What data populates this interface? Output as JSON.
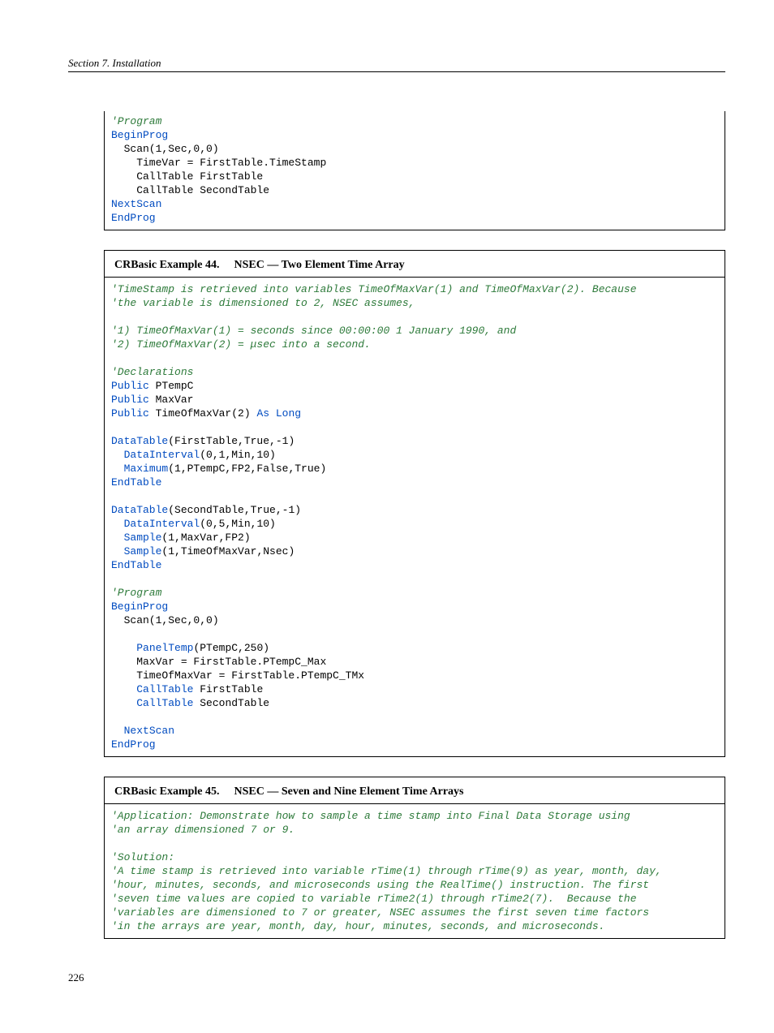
{
  "header": {
    "text": "Section 7.  Installation"
  },
  "footer": {
    "page_number": "226"
  },
  "box1": {
    "code": [
      {
        "t": "cm",
        "v": "'Program"
      },
      {
        "t": "kw",
        "v": "BeginProg"
      },
      {
        "t": "pl",
        "v": "  Scan(1,Sec,0,0)"
      },
      {
        "t": "pl",
        "v": "    TimeVar = FirstTable.TimeStamp"
      },
      {
        "t": "pl",
        "v": "    CallTable FirstTable"
      },
      {
        "t": "pl",
        "v": "    CallTable SecondTable"
      },
      {
        "t": "mx",
        "v": "  ",
        "kw": "NextScan"
      },
      {
        "t": "kw",
        "v": "EndProg"
      }
    ]
  },
  "box2": {
    "title_prefix": "CRBasic Example 44.",
    "title_rest": "NSEC — Two Element Time Array",
    "code": [
      {
        "t": "cm",
        "v": "'TimeStamp is retrieved into variables TimeOfMaxVar(1) and TimeOfMaxVar(2). Because"
      },
      {
        "t": "cm",
        "v": "'the variable is dimensioned to 2, NSEC assumes,"
      },
      {
        "t": "pl",
        "v": ""
      },
      {
        "t": "cm",
        "v": "'1) TimeOfMaxVar(1) = seconds since 00:00:00 1 January 1990, and"
      },
      {
        "t": "cm",
        "v": "'2) TimeOfMaxVar(2) = μsec into a second."
      },
      {
        "t": "pl",
        "v": ""
      },
      {
        "t": "cm",
        "v": "'Declarations"
      },
      {
        "t": "mx",
        "kw": "Public",
        "v": " PTempC"
      },
      {
        "t": "mx",
        "kw": "Public",
        "v": " MaxVar"
      },
      {
        "t": "mx3",
        "kw": "Public",
        "mid": " TimeOfMaxVar(2) ",
        "kw2": "As Long"
      },
      {
        "t": "pl",
        "v": ""
      },
      {
        "t": "mx",
        "kw": "DataTable",
        "v": "(FirstTable,True,-1)"
      },
      {
        "t": "mx",
        "pre": "  ",
        "kw": "DataInterval",
        "v": "(0,1,Min,10)"
      },
      {
        "t": "mx",
        "pre": "  ",
        "kw": "Maximum",
        "v": "(1,PTempC,FP2,False,True)"
      },
      {
        "t": "kw",
        "v": "EndTable"
      },
      {
        "t": "pl",
        "v": ""
      },
      {
        "t": "mx",
        "kw": "DataTable",
        "v": "(SecondTable,True,-1)"
      },
      {
        "t": "mx",
        "pre": "  ",
        "kw": "DataInterval",
        "v": "(0,5,Min,10)"
      },
      {
        "t": "mx",
        "pre": "  ",
        "kw": "Sample",
        "v": "(1,MaxVar,FP2)"
      },
      {
        "t": "mx",
        "pre": "  ",
        "kw": "Sample",
        "v": "(1,TimeOfMaxVar,Nsec)"
      },
      {
        "t": "kw",
        "v": "EndTable"
      },
      {
        "t": "pl",
        "v": ""
      },
      {
        "t": "cm",
        "v": "'Program"
      },
      {
        "t": "kw",
        "v": "BeginProg"
      },
      {
        "t": "pl",
        "v": "  Scan(1,Sec,0,0)"
      },
      {
        "t": "pl",
        "v": ""
      },
      {
        "t": "mx",
        "pre": "    ",
        "kw": "PanelTemp",
        "v": "(PTempC,250)"
      },
      {
        "t": "pl",
        "v": "    MaxVar = FirstTable.PTempC_Max"
      },
      {
        "t": "pl",
        "v": "    TimeOfMaxVar = FirstTable.PTempC_TMx"
      },
      {
        "t": "mx",
        "pre": "    ",
        "kw": "CallTable",
        "v": " FirstTable"
      },
      {
        "t": "mx",
        "pre": "    ",
        "kw": "CallTable",
        "v": " SecondTable"
      },
      {
        "t": "pl",
        "v": ""
      },
      {
        "t": "mx",
        "pre": "  ",
        "kw": "NextScan",
        "v": ""
      },
      {
        "t": "kw",
        "v": "EndProg"
      }
    ]
  },
  "box3": {
    "title_prefix": "CRBasic Example 45.",
    "title_rest": "NSEC — Seven and Nine Element Time Arrays",
    "code": [
      {
        "t": "cm",
        "v": "'Application: Demonstrate how to sample a time stamp into Final Data Storage using"
      },
      {
        "t": "cm",
        "v": "'an array dimensioned 7 or 9."
      },
      {
        "t": "pl",
        "v": ""
      },
      {
        "t": "cm",
        "v": "'Solution:"
      },
      {
        "t": "cm",
        "v": "'A time stamp is retrieved into variable rTime(1) through rTime(9) as year, month, day,"
      },
      {
        "t": "cm",
        "v": "'hour, minutes, seconds, and microseconds using the RealTime() instruction. The first"
      },
      {
        "t": "cm",
        "v": "'seven time values are copied to variable rTime2(1) through rTime2(7).  Because the"
      },
      {
        "t": "cm",
        "v": "'variables are dimensioned to 7 or greater, NSEC assumes the first seven time factors"
      },
      {
        "t": "cm",
        "v": "'in the arrays are year, month, day, hour, minutes, seconds, and microseconds."
      }
    ]
  }
}
